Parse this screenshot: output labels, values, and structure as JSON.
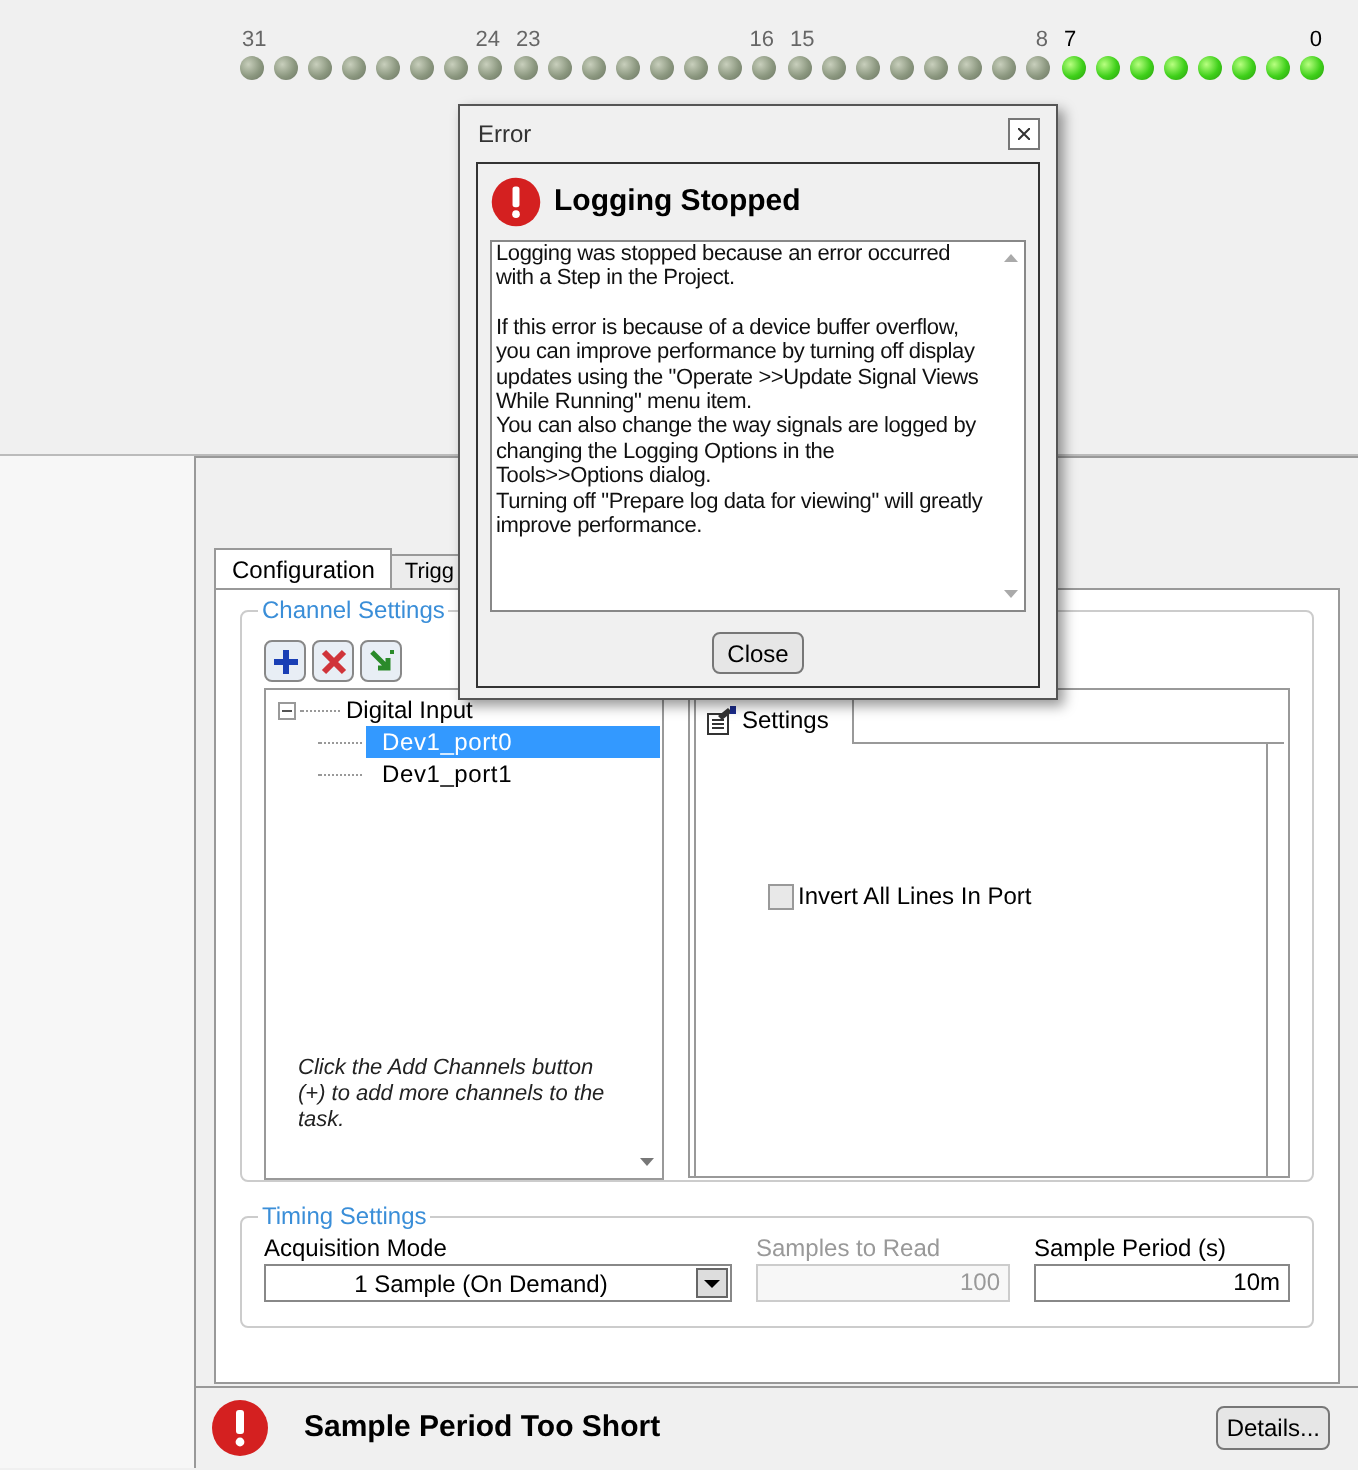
{
  "indicator_groups": [
    {
      "start_label": "31",
      "end_label": "24",
      "leds": [
        false,
        false,
        false,
        false,
        false,
        false,
        false,
        false
      ]
    },
    {
      "start_label": "23",
      "end_label": "16",
      "leds": [
        false,
        false,
        false,
        false,
        false,
        false,
        false,
        false
      ]
    },
    {
      "start_label": "15",
      "end_label": "8",
      "leds": [
        false,
        false,
        false,
        false,
        false,
        false,
        false,
        false
      ]
    },
    {
      "start_label": "7",
      "end_label": "0",
      "leds": [
        true,
        true,
        true,
        true,
        true,
        true,
        true,
        true
      ]
    }
  ],
  "tabs": [
    {
      "label": "Configuration",
      "selected": true
    },
    {
      "label": "Trigg",
      "selected": false
    }
  ],
  "channel_settings": {
    "legend": "Channel Settings",
    "tree": [
      {
        "label": "Digital Input",
        "expanded": true,
        "selected": false,
        "children": [
          {
            "label": "Dev1_port0",
            "selected": true
          },
          {
            "label": "Dev1_port1",
            "selected": false
          }
        ]
      }
    ],
    "hint": "Click the Add Channels button (+) to add more channels to the task.",
    "settings_tab": "Settings",
    "invert_checkbox": {
      "label": "Invert All Lines In Port",
      "checked": false
    }
  },
  "timing_settings": {
    "legend": "Timing Settings",
    "acquisition_mode": {
      "label": "Acquisition Mode",
      "value": "1 Sample (On Demand)"
    },
    "samples_to_read": {
      "label": "Samples to Read",
      "value": "100",
      "disabled": true
    },
    "sample_period": {
      "label": "Sample Period (s)",
      "value": "10m"
    }
  },
  "status": {
    "message": "Sample Period Too Short",
    "button": "Details..."
  },
  "dialog": {
    "title": "Error",
    "heading": "Logging Stopped",
    "paragraphs": [
      "Logging was stopped because an error occurred with a Step in the Project.",
      "If this error is because of a device buffer overflow, you can improve performance by turning off display updates using the \"Operate >>Update Signal Views While Running\" menu item.\nYou can also change the way signals are logged by changing the Logging Options in the Tools>>Options dialog.\nTurning off \"Prepare log data for viewing\" will greatly improve performance."
    ],
    "button": "Close"
  }
}
